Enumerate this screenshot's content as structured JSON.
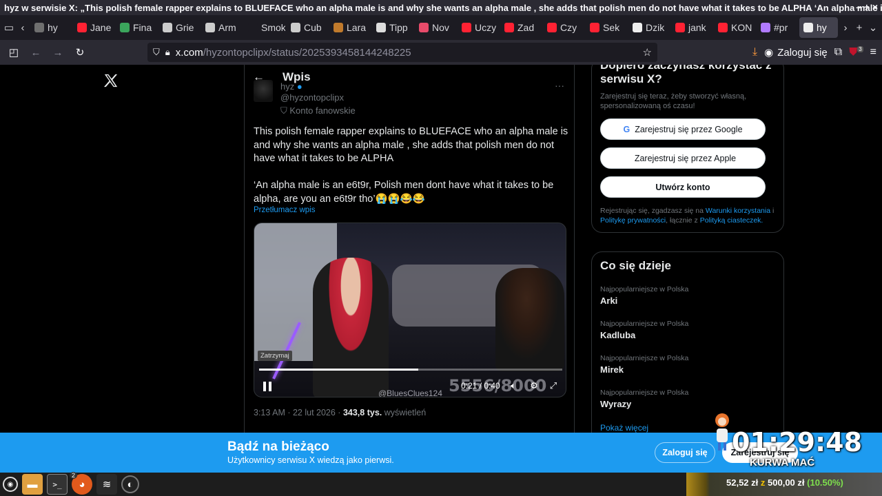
{
  "window": {
    "title": "hyz w serwisie X: „This polish female rapper explains to BLUEFACE who an alpha male is and why she wants an alpha male , she adds that polish men do not have what it takes to be ALPHA ‘An alpha male is a...",
    "controls": "–  +  ×"
  },
  "tabs": [
    {
      "label": "hy",
      "color": "#6f6f6f"
    },
    {
      "label": "Jane",
      "color": "#ff2233"
    },
    {
      "label": "Fina",
      "color": "#3ba55c"
    },
    {
      "label": "Grie",
      "color": "#cccccc"
    },
    {
      "label": "Arm",
      "color": "#cccccc"
    },
    {
      "label": "Smoke",
      "color": "#1c1b22"
    },
    {
      "label": "Cub",
      "color": "#cccccc"
    },
    {
      "label": "Lara",
      "color": "#c07a2c"
    },
    {
      "label": "Tipp",
      "color": "#dddddd"
    },
    {
      "label": "Nov",
      "color": "#e84b6a"
    },
    {
      "label": "Uczy",
      "color": "#ff2233"
    },
    {
      "label": "Zad",
      "color": "#ff2233"
    },
    {
      "label": "Czy",
      "color": "#ff2233"
    },
    {
      "label": "Sek",
      "color": "#ff2233"
    },
    {
      "label": "Dzik",
      "color": "#eeeeee"
    },
    {
      "label": "jank",
      "color": "#ff2233"
    },
    {
      "label": "KON",
      "color": "#ff2233"
    },
    {
      "label": "#pr",
      "color": "#b07aff"
    },
    {
      "label": "hy",
      "color": "#eeeeee",
      "active": true
    }
  ],
  "address": {
    "host": "x.com",
    "path": "/hyzontopclipx/status/2025393458144248225"
  },
  "nav": {
    "login_label": "Zaloguj się",
    "badge": "3"
  },
  "post": {
    "header_title": "Wpis",
    "display_name": "hyz",
    "handle": "@hyzontopclipx",
    "fan_account": "Konto fanowskie",
    "text_p1": "This polish female rapper explains to BLUEFACE who an alpha male is and why she wants an alpha male , she adds that polish men do not have what it takes to be ALPHA",
    "text_p2": "‘An alpha male is an e6t9r, Polish men dont have what it takes to be alpha, are you an e6t9r tho’😭😭😂😂",
    "translate": "Przetłumacz wpis",
    "timestamp": "3:13 AM · 22 lut 2026 ·",
    "views": "343,8 tys.",
    "views_label": "wyświetleń"
  },
  "video": {
    "tooltip": "Zatrzymaj",
    "time": "0:21 / 0:40",
    "watermark": "5556/8000",
    "source_tag": "@BluesClues124",
    "progress": 0.525
  },
  "signup": {
    "title": "Dopiero zaczynasz korzystać z serwisu X?",
    "subtitle": "Zarejestruj się teraz, żeby stworzyć własną, spersonalizowaną oś czasu!",
    "google_btn": "Zarejestruj się przez Google",
    "apple_btn": "Zarejestruj się przez Apple",
    "create_btn": "Utwórz konto",
    "legal_prefix": "Rejestrując się, zgadzasz się na",
    "legal_terms": "Warunki korzystania",
    "legal_i": "i",
    "legal_privacy": "Politykę prywatności",
    "legal_mid": ", łącznie z",
    "legal_cookies": "Polityką ciasteczek."
  },
  "trends": {
    "title": "Co się dzieje",
    "items": [
      {
        "category": "Najpopularniejsze w Polska",
        "name": "Arki"
      },
      {
        "category": "Najpopularniejsze w Polska",
        "name": "Kadluba"
      },
      {
        "category": "Najpopularniejsze w Polska",
        "name": "Mirek"
      },
      {
        "category": "Najpopularniejsze w Polska",
        "name": "Wyrazy"
      }
    ],
    "show_more": "Pokaż więcej"
  },
  "banner": {
    "title": "Bądź na bieżąco",
    "subtitle": "Użytkownicy serwisu X wiedzą jako pierwsi.",
    "login": "Zaloguj się",
    "signup": "Zarejestruj się"
  },
  "overlay": {
    "clock": "01:29:48",
    "caption": "KURWA MAĆ"
  },
  "taskbar": {
    "badge": "2"
  },
  "donation": {
    "current": "52,52 zł",
    "sep": "z",
    "goal": "500,00 zł",
    "percent": "(10.50%)"
  }
}
